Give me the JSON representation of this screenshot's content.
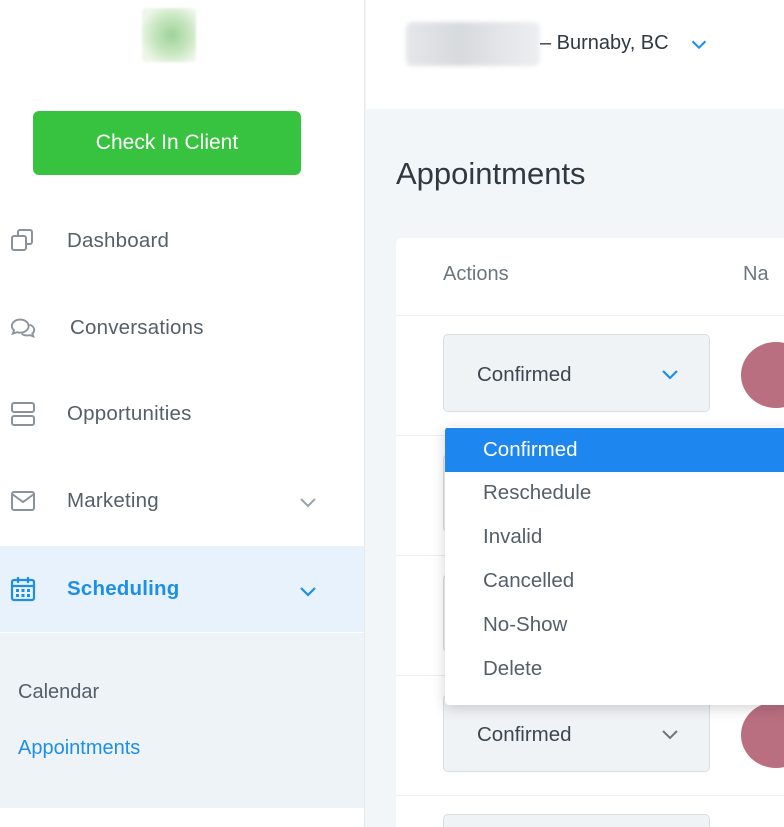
{
  "sidebar": {
    "check_in_label": "Check In Client",
    "items": [
      {
        "label": "Dashboard",
        "icon": "dashboard-icon"
      },
      {
        "label": "Conversations",
        "icon": "conversations-icon"
      },
      {
        "label": "Opportunities",
        "icon": "opportunities-icon"
      },
      {
        "label": "Marketing",
        "icon": "marketing-icon"
      },
      {
        "label": "Scheduling",
        "icon": "calendar-icon",
        "active": true
      }
    ],
    "sub_items": [
      {
        "label": "Calendar"
      },
      {
        "label": "Appointments",
        "active": true
      }
    ]
  },
  "topbar": {
    "location_suffix": "– Burnaby, BC"
  },
  "main": {
    "title": "Appointments",
    "columns": [
      "Actions",
      "Na"
    ],
    "rows": [
      {
        "status": "Confirmed"
      },
      {
        "status": ""
      },
      {
        "status": ""
      },
      {
        "status": "Confirmed"
      }
    ]
  },
  "dropdown": {
    "selected": "Confirmed",
    "options": [
      "Confirmed",
      "Reschedule",
      "Invalid",
      "Cancelled",
      "No-Show",
      "Delete"
    ]
  },
  "colors": {
    "accent": "#1d87ef",
    "check_in_green": "#37c33f",
    "active_nav_bg": "#e8f2fd",
    "avatar": "#b96f80"
  }
}
